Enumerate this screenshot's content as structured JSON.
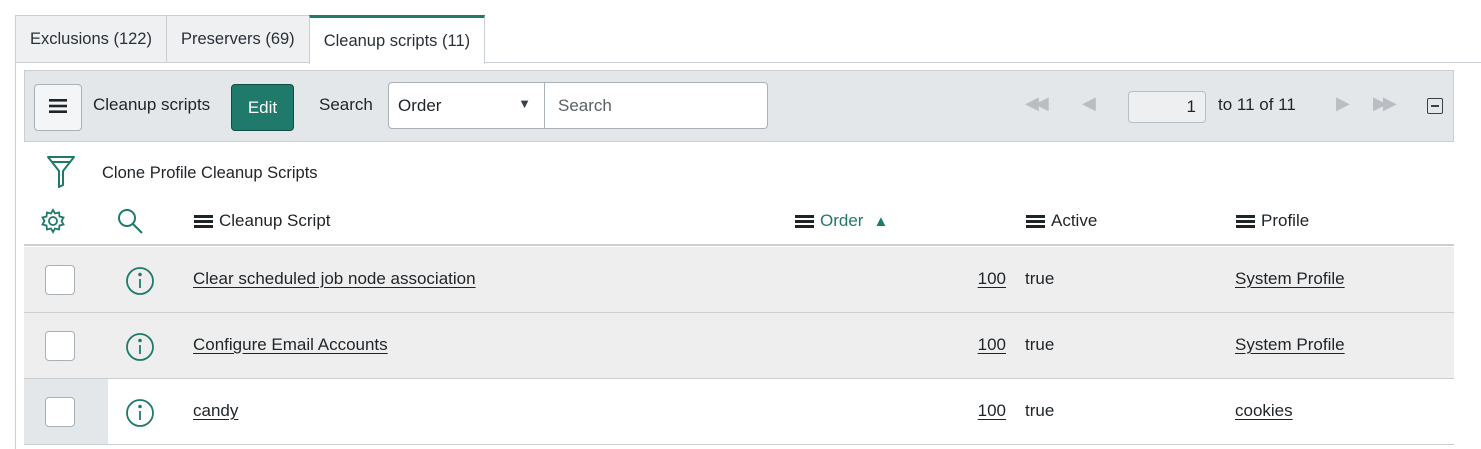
{
  "tabs": [
    {
      "label": "Exclusions (122)"
    },
    {
      "label": "Preservers (69)"
    },
    {
      "label": "Cleanup scripts (11)"
    }
  ],
  "toolbar": {
    "list_title": "Cleanup scripts",
    "edit_label": "Edit",
    "search_label": "Search",
    "search_field_selected": "Order",
    "search_placeholder": "Search",
    "page_number": "1",
    "page_range": "to 11 of 11"
  },
  "breadcrumb": "Clone Profile Cleanup Scripts",
  "columns": {
    "script": "Cleanup Script",
    "order": "Order",
    "active": "Active",
    "profile": "Profile"
  },
  "rows": [
    {
      "script": "Clear scheduled job node association",
      "order": "100",
      "active": "true",
      "profile": "System Profile"
    },
    {
      "script": "Configure Email Accounts",
      "order": "100",
      "active": "true",
      "profile": "System Profile"
    },
    {
      "script": "candy",
      "order": "100",
      "active": "true",
      "profile": "cookies"
    }
  ],
  "colors": {
    "accent": "#1f7a6b",
    "row_shade": "#eeeeee",
    "toolbar_bg": "#e4e7e9"
  },
  "icons": [
    "list-menu-icon",
    "filter-funnel-icon",
    "gear-icon",
    "search-icon",
    "info-icon",
    "sort-ascending-icon",
    "first-page-icon",
    "prev-page-icon",
    "next-page-icon",
    "last-page-icon",
    "collapse-icon"
  ]
}
